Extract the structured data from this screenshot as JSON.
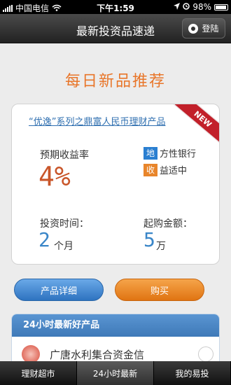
{
  "status_bar": {
    "carrier": "中国电信",
    "time": "下午1:59",
    "battery": "98%"
  },
  "nav": {
    "title": "最新投资品速递",
    "login_label": "登陆"
  },
  "page": {
    "title": "每日新品推荐"
  },
  "product": {
    "name": "“优逸”系列之鼎富人民币理财产品",
    "badge": "NEW",
    "yield_label": "预期收益率",
    "yield_value": "4%",
    "tags": [
      {
        "icon": "地",
        "text": "方性银行",
        "color": "#2a7fd1"
      },
      {
        "icon": "收",
        "text": "益适中",
        "color": "#e8852b"
      }
    ],
    "term_label": "投资时间：",
    "term_value": "2",
    "term_unit": "个月",
    "min_label": "起购金额：",
    "min_value": "5",
    "min_unit": "万"
  },
  "buttons": {
    "detail": "产品详细",
    "buy": "购买"
  },
  "panel": {
    "title": "24小时最新好产品",
    "item_text": "广唐水利集合资金信"
  },
  "tabs": [
    {
      "label": "理财超市",
      "active": false
    },
    {
      "label": "24小时最新",
      "active": true
    },
    {
      "label": "我的易投",
      "active": false
    }
  ]
}
